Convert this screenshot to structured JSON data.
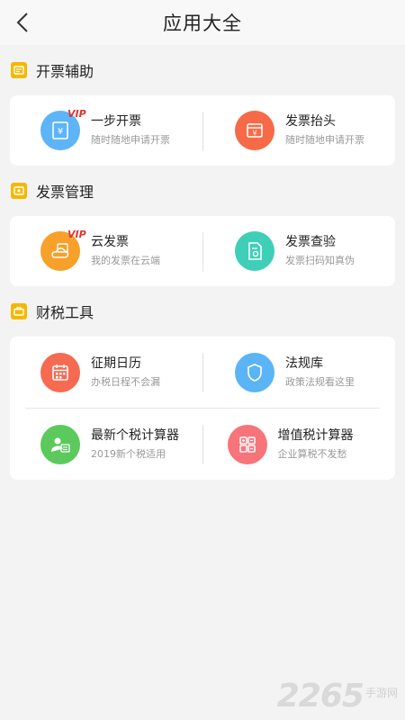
{
  "header": {
    "title": "应用大全"
  },
  "sections": [
    {
      "title": "开票辅助",
      "rows": [
        [
          {
            "title": "一步开票",
            "subtitle": "随时随地申请开票",
            "badge": "VIP",
            "icon": "invoice-yen-icon",
            "color": "#5db4f7"
          },
          {
            "title": "发票抬头",
            "subtitle": "随时随地申请开票",
            "icon": "invoice-header-icon",
            "color": "#f76a48"
          }
        ]
      ]
    },
    {
      "title": "发票管理",
      "rows": [
        [
          {
            "title": "云发票",
            "subtitle": "我的发票在云端",
            "badge": "VIP",
            "icon": "cloud-invoice-icon",
            "color": "#f7a02a"
          },
          {
            "title": "发票查验",
            "subtitle": "发票扫码知真伪",
            "icon": "invoice-verify-icon",
            "color": "#3fcfb8"
          }
        ]
      ]
    },
    {
      "title": "财税工具",
      "rows": [
        [
          {
            "title": "征期日历",
            "subtitle": "办税日程不会漏",
            "icon": "calendar-icon",
            "color": "#f76a52"
          },
          {
            "title": "法规库",
            "subtitle": "政策法规看这里",
            "icon": "law-shield-icon",
            "color": "#5bb4f5"
          }
        ],
        [
          {
            "title": "最新个税计算器",
            "subtitle": "2019新个税适用",
            "icon": "personal-tax-icon",
            "color": "#5cc95d"
          },
          {
            "title": "增值税计算器",
            "subtitle": "企业算税不发愁",
            "icon": "calculator-icon",
            "color": "#f7747a"
          }
        ]
      ]
    }
  ],
  "watermark": {
    "number": "2265",
    "text": "手游网"
  }
}
